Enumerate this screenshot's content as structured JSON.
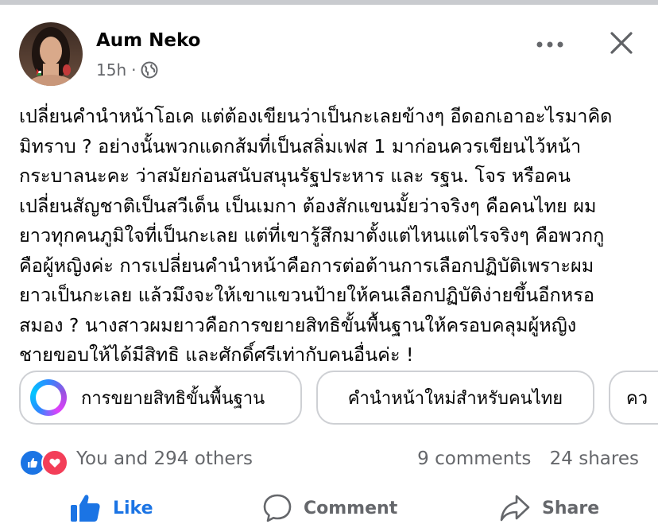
{
  "post": {
    "author": "Aum Neko",
    "time": "15h",
    "separator": "·",
    "privacy_icon": "globe-icon",
    "lines": [
      "เปลี่ยนคำนำหน้าโอเค แต่ต้องเขียนว่าเป็นกะเลยข้างๆ อีดอกเอาอะไรมาคิด",
      "มิทราบ ? อย่างนั้นพวกแดกส้มที่เป็นสลิ่มเฟส 1 มาก่อนควรเขียนไว้หน้า",
      "กระบาลนะคะ ว่าสมัยก่อนสนับสนุนรัฐประหาร และ รฐน. โจร หรือคน",
      "เปลี่ยนสัญชาติเป็นสวีเด็น เป็นเมกา ต้องสักแขนมั้ยว่าจริงๆ คือคนไทย ผม",
      "ยาวทุกคนภูมิใจที่เป็นกะเลย แต่ที่เขารู้สึกมาตั้งแต่ไหนแต่ไรจริงๆ คือพวกกู",
      "คือผู้หญิงค่ะ การเปลี่ยนคำนำหน้าคือการต่อต้านการเลือกปฏิบัติเพราะผม",
      "ยาวเป็นกะเลย แล้วมึงจะให้เขาแขวนป้ายให้คนเลือกปฏิบัติง่ายขึ้นอีกหรอ",
      "สมอง ? นางสาวผมยาวคือการขยายสิทธิขั้นพื้นฐานให้ครอบคลุมผู้หญิง",
      "ชายขอบให้ได้มีสิทธิ และศักดิ์ศรีเท่ากับคนอื่นค่ะ !"
    ]
  },
  "chips": [
    {
      "label": "การขยายสิทธิขั้นพื้นฐาน",
      "icon": "ai-search-ring-icon"
    },
    {
      "label": "คำนำหน้าใหม่สำหรับคนไทย"
    },
    {
      "label": "คว"
    }
  ],
  "engagement": {
    "reactions_text": "You and 294 others",
    "comments": "9 comments",
    "shares": "24 shares",
    "reaction_icons": [
      "like-icon",
      "love-icon"
    ]
  },
  "actions": {
    "like": "Like",
    "comment": "Comment",
    "share": "Share"
  },
  "colors": {
    "accent": "#1b74e4",
    "love": "#f33e58",
    "secondary_text": "#65676b",
    "divider": "#c9cbcf"
  }
}
